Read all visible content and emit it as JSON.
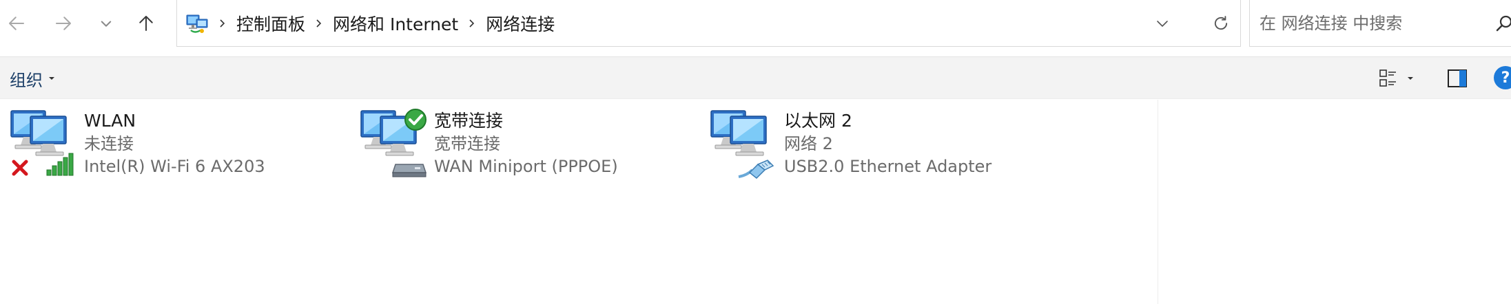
{
  "breadcrumb": {
    "items": [
      "控制面板",
      "网络和 Internet",
      "网络连接"
    ]
  },
  "search": {
    "placeholder": "在 网络连接 中搜索"
  },
  "toolbar": {
    "organize_label": "组织",
    "help_label": "?"
  },
  "connections": [
    {
      "name": "WLAN",
      "status": "未连接",
      "device": "Intel(R) Wi-Fi 6 AX203",
      "badge_icon": "disconnected-x-icon",
      "device_icon": "wifi-signal-icon"
    },
    {
      "name": "宽带连接",
      "status": "宽带连接",
      "device": "WAN Miniport (PPPOE)",
      "badge_icon": "connected-check-icon",
      "device_icon": "modem-icon"
    },
    {
      "name": "以太网 2",
      "status": "网络 2",
      "device": "USB2.0 Ethernet Adapter",
      "badge_icon": "",
      "device_icon": "ethernet-cable-icon"
    }
  ],
  "colors": {
    "accent": "#1c7ad9",
    "command_bar_bg": "#f3f3f3",
    "organize_text": "#1a3d66",
    "secondary_text": "#6b6b6b"
  }
}
